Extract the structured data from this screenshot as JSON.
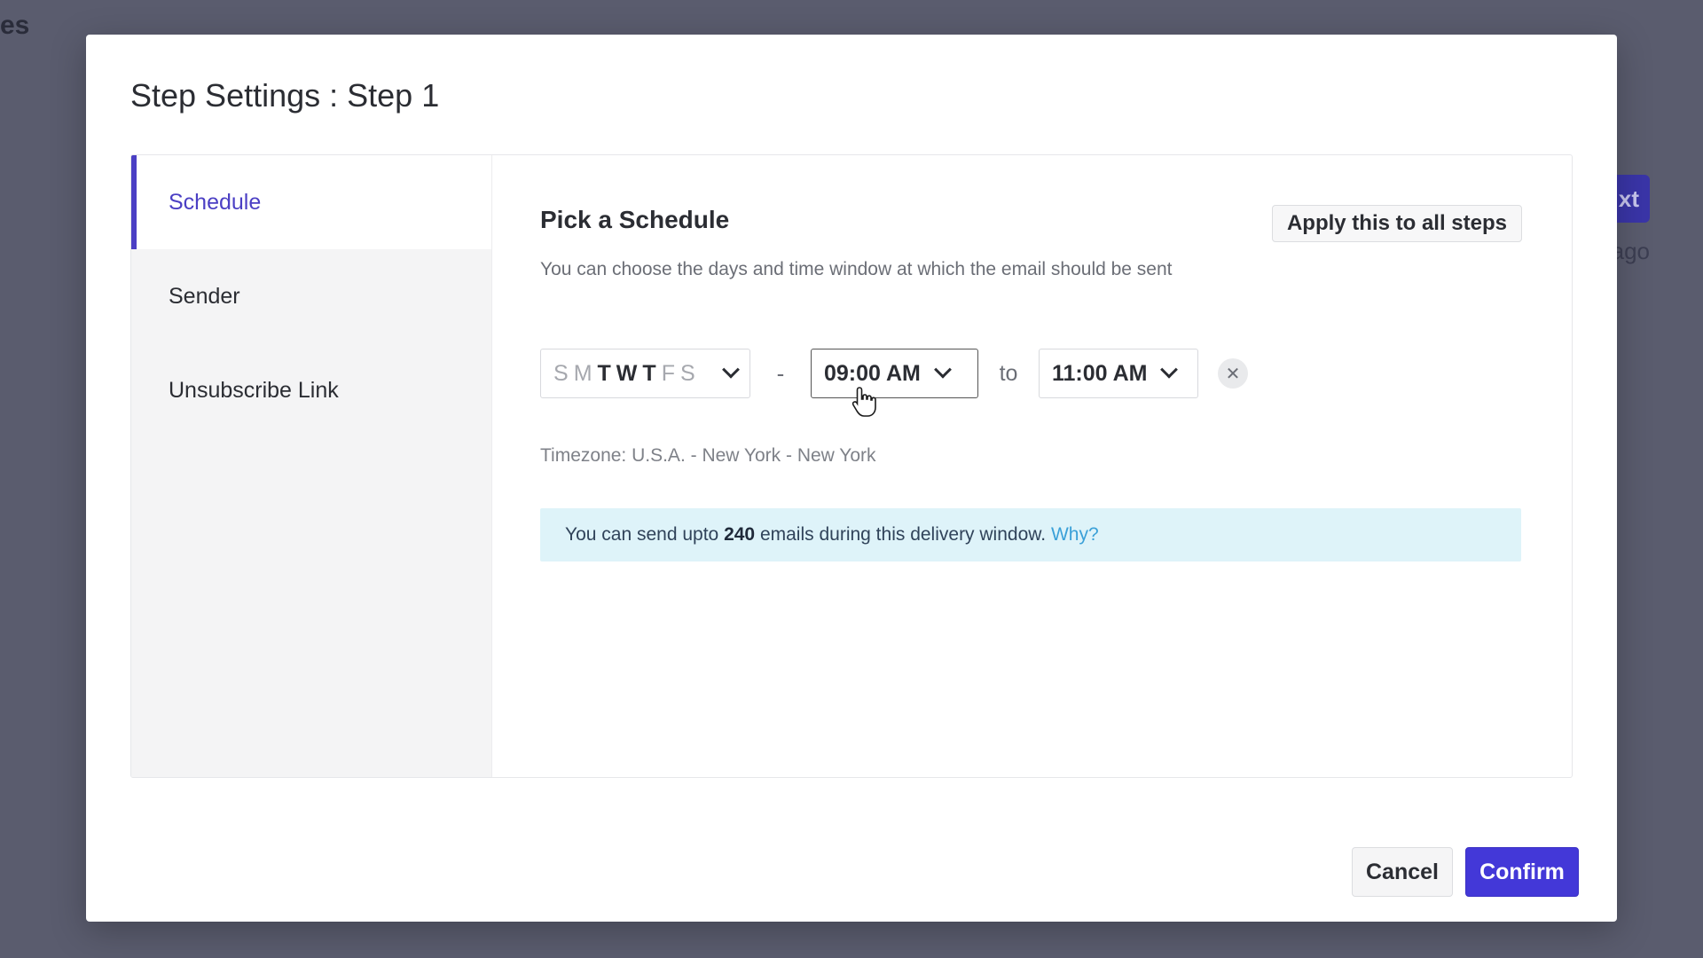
{
  "background": {
    "partial_title": "es",
    "partial_button": "xt",
    "partial_text": "ago"
  },
  "modal": {
    "title": "Step Settings : Step 1",
    "sidebar": {
      "items": [
        {
          "label": "Schedule",
          "active": true
        },
        {
          "label": "Sender",
          "active": false
        },
        {
          "label": "Unsubscribe Link",
          "active": false
        }
      ]
    },
    "schedule": {
      "title": "Pick a Schedule",
      "description": "You can choose the days and time window at which the email should be sent",
      "apply_all_label": "Apply this to all steps",
      "days": [
        {
          "letter": "S",
          "selected": false
        },
        {
          "letter": "M",
          "selected": false
        },
        {
          "letter": "T",
          "selected": true
        },
        {
          "letter": "W",
          "selected": true
        },
        {
          "letter": "T",
          "selected": true
        },
        {
          "letter": "F",
          "selected": false
        },
        {
          "letter": "S",
          "selected": false
        }
      ],
      "separator": "-",
      "start_time": "09:00 AM",
      "to_label": "to",
      "end_time": "11:00 AM",
      "clear_icon": "close-icon",
      "timezone": "Timezone: U.S.A. - New York - New York",
      "info": {
        "prefix": "You can send upto",
        "count": "240",
        "suffix": "emails during this delivery window.",
        "link": "Why?"
      }
    },
    "footer": {
      "cancel_label": "Cancel",
      "confirm_label": "Confirm"
    }
  },
  "colors": {
    "accent": "#4b3fc4",
    "confirm": "#4338d8",
    "info_bg": "#def3f9",
    "link": "#3aa0d8"
  }
}
